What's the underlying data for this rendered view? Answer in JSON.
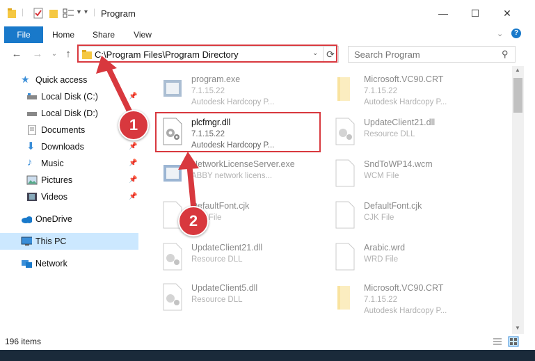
{
  "window": {
    "title": "Program",
    "minimize": "—",
    "maximize": "☐",
    "close": "✕"
  },
  "ribbon": {
    "file": "File",
    "home": "Home",
    "share": "Share",
    "view": "View",
    "help": "?"
  },
  "address": {
    "path": "C:\\Program Files\\Program Directory",
    "search_placeholder": "Search Program"
  },
  "nav": [
    {
      "label": "Quick access",
      "icon": "star-icon",
      "pinned": false
    },
    {
      "label": "Local Disk (C:)",
      "icon": "drive-icon",
      "pinned": true
    },
    {
      "label": "Local Disk (D:)",
      "icon": "drive-icon",
      "pinned": false
    },
    {
      "label": "Documents",
      "icon": "documents-icon",
      "pinned": true
    },
    {
      "label": "Downloads",
      "icon": "download-icon",
      "pinned": true
    },
    {
      "label": "Music",
      "icon": "music-icon",
      "pinned": true
    },
    {
      "label": "Pictures",
      "icon": "pictures-icon",
      "pinned": true
    },
    {
      "label": "Videos",
      "icon": "videos-icon",
      "pinned": true
    },
    {
      "label": "OneDrive",
      "icon": "cloud-icon",
      "pinned": false
    },
    {
      "label": "This PC",
      "icon": "computer-icon",
      "pinned": false
    },
    {
      "label": "Network",
      "icon": "network-icon",
      "pinned": false
    }
  ],
  "files": [
    {
      "name": "program.exe",
      "line2": "7.1.15.22",
      "line3": "Autodesk Hardcopy P...",
      "icon": "exe"
    },
    {
      "name": "Microsoft.VC90.CRT",
      "line2": "7.1.15.22",
      "line3": "Autodesk Hardcopy P...",
      "icon": "folder"
    },
    {
      "name": "plcfmgr.dll",
      "line2": "7.1.15.22",
      "line3": "Autodesk Hardcopy P...",
      "icon": "dll"
    },
    {
      "name": "UpdateClient21.dll",
      "line2": "Resource DLL",
      "line3": "",
      "icon": "dll"
    },
    {
      "name": "NetworkLicenseServer.exe",
      "line2": "ABBY network licens...",
      "line3": "",
      "icon": "exe"
    },
    {
      "name": "SndToWP14.wcm",
      "line2": "WCM File",
      "line3": "",
      "icon": "doc"
    },
    {
      "name": "DefaultFont.cjk",
      "line2": "CJK File",
      "line3": "",
      "icon": "doc"
    },
    {
      "name": "DefaultFont.cjk",
      "line2": "CJK File",
      "line3": "",
      "icon": "doc"
    },
    {
      "name": "UpdateClient21.dll",
      "line2": "Resource DLL",
      "line3": "",
      "icon": "dll"
    },
    {
      "name": "Arabic.wrd",
      "line2": "WRD File",
      "line3": "",
      "icon": "doc"
    },
    {
      "name": "UpdateClient5.dll",
      "line2": "Resource DLL",
      "line3": "",
      "icon": "dll"
    },
    {
      "name": "Microsoft.VC90.CRT",
      "line2": "7.1.15.22",
      "line3": "Autodesk Hardcopy P...",
      "icon": "folder"
    }
  ],
  "status": {
    "count": "196 items"
  },
  "callouts": [
    "1",
    "2"
  ],
  "colors": {
    "accent": "#1979ca",
    "highlight": "#d8383e",
    "selection": "#cce8ff"
  }
}
